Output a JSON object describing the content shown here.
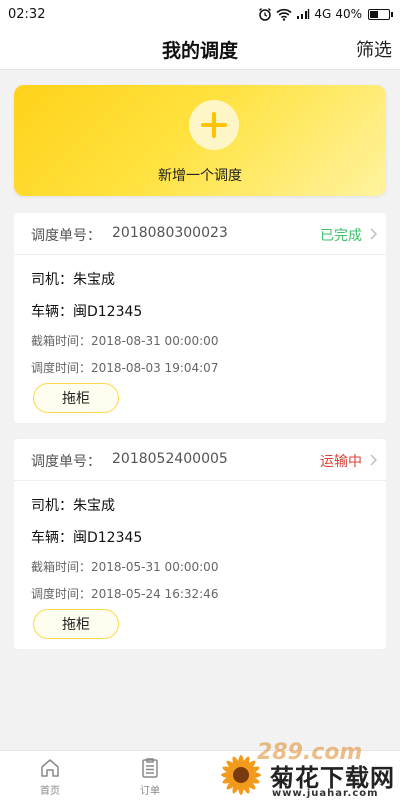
{
  "status_bar": {
    "time": "02:32",
    "network": "4G",
    "battery": "40%",
    "battery_level": 0.4
  },
  "nav": {
    "title": "我的调度",
    "filter_label": "筛选"
  },
  "add_card": {
    "label": "新增一个调度"
  },
  "orders": [
    {
      "order_label": "调度单号：",
      "order_no": "2018080300023",
      "status": "已完成",
      "status_color": "#3fbf6a",
      "driver": "司机：朱宝成",
      "vehicle": "车辆：闽D12345",
      "cutoff_time": "截箱时间：2018-08-31 00:00:00",
      "dispatch_time": "调度时间：2018-08-03 19:04:07",
      "action_label": "拖柜"
    },
    {
      "order_label": "调度单号：",
      "order_no": "2018052400005",
      "status": "运输中",
      "status_color": "#d9453b",
      "driver": "司机：朱宝成",
      "vehicle": "车辆：闽D12345",
      "cutoff_time": "截箱时间：2018-05-31 00:00:00",
      "dispatch_time": "调度时间：2018-05-24 16:32:46",
      "action_label": "拖柜"
    }
  ],
  "tabs": [
    {
      "label": "首页",
      "icon": "home-icon"
    },
    {
      "label": "订单",
      "icon": "order-icon"
    }
  ],
  "watermark": {
    "logo": "289.com",
    "title": "菊花下载网",
    "url": "www.juahar.com"
  },
  "colors": {
    "accent": "#ffd21a"
  }
}
